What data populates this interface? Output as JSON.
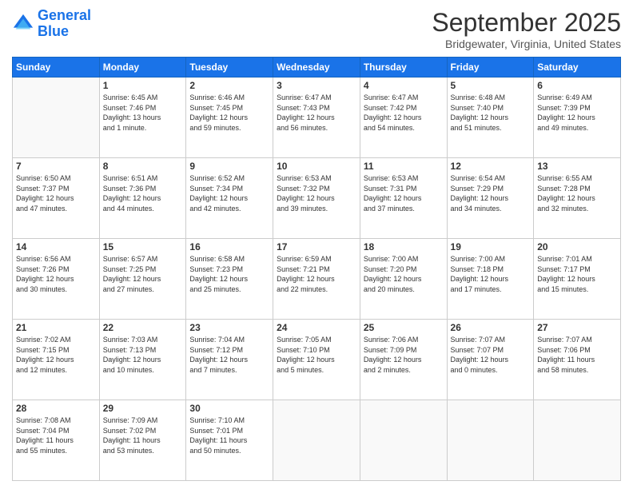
{
  "app": {
    "name_part1": "General",
    "name_part2": "Blue"
  },
  "title": "September 2025",
  "location": "Bridgewater, Virginia, United States",
  "days_of_week": [
    "Sunday",
    "Monday",
    "Tuesday",
    "Wednesday",
    "Thursday",
    "Friday",
    "Saturday"
  ],
  "weeks": [
    [
      {
        "day": "",
        "info": ""
      },
      {
        "day": "1",
        "info": "Sunrise: 6:45 AM\nSunset: 7:46 PM\nDaylight: 13 hours\nand 1 minute."
      },
      {
        "day": "2",
        "info": "Sunrise: 6:46 AM\nSunset: 7:45 PM\nDaylight: 12 hours\nand 59 minutes."
      },
      {
        "day": "3",
        "info": "Sunrise: 6:47 AM\nSunset: 7:43 PM\nDaylight: 12 hours\nand 56 minutes."
      },
      {
        "day": "4",
        "info": "Sunrise: 6:47 AM\nSunset: 7:42 PM\nDaylight: 12 hours\nand 54 minutes."
      },
      {
        "day": "5",
        "info": "Sunrise: 6:48 AM\nSunset: 7:40 PM\nDaylight: 12 hours\nand 51 minutes."
      },
      {
        "day": "6",
        "info": "Sunrise: 6:49 AM\nSunset: 7:39 PM\nDaylight: 12 hours\nand 49 minutes."
      }
    ],
    [
      {
        "day": "7",
        "info": "Sunrise: 6:50 AM\nSunset: 7:37 PM\nDaylight: 12 hours\nand 47 minutes."
      },
      {
        "day": "8",
        "info": "Sunrise: 6:51 AM\nSunset: 7:36 PM\nDaylight: 12 hours\nand 44 minutes."
      },
      {
        "day": "9",
        "info": "Sunrise: 6:52 AM\nSunset: 7:34 PM\nDaylight: 12 hours\nand 42 minutes."
      },
      {
        "day": "10",
        "info": "Sunrise: 6:53 AM\nSunset: 7:32 PM\nDaylight: 12 hours\nand 39 minutes."
      },
      {
        "day": "11",
        "info": "Sunrise: 6:53 AM\nSunset: 7:31 PM\nDaylight: 12 hours\nand 37 minutes."
      },
      {
        "day": "12",
        "info": "Sunrise: 6:54 AM\nSunset: 7:29 PM\nDaylight: 12 hours\nand 34 minutes."
      },
      {
        "day": "13",
        "info": "Sunrise: 6:55 AM\nSunset: 7:28 PM\nDaylight: 12 hours\nand 32 minutes."
      }
    ],
    [
      {
        "day": "14",
        "info": "Sunrise: 6:56 AM\nSunset: 7:26 PM\nDaylight: 12 hours\nand 30 minutes."
      },
      {
        "day": "15",
        "info": "Sunrise: 6:57 AM\nSunset: 7:25 PM\nDaylight: 12 hours\nand 27 minutes."
      },
      {
        "day": "16",
        "info": "Sunrise: 6:58 AM\nSunset: 7:23 PM\nDaylight: 12 hours\nand 25 minutes."
      },
      {
        "day": "17",
        "info": "Sunrise: 6:59 AM\nSunset: 7:21 PM\nDaylight: 12 hours\nand 22 minutes."
      },
      {
        "day": "18",
        "info": "Sunrise: 7:00 AM\nSunset: 7:20 PM\nDaylight: 12 hours\nand 20 minutes."
      },
      {
        "day": "19",
        "info": "Sunrise: 7:00 AM\nSunset: 7:18 PM\nDaylight: 12 hours\nand 17 minutes."
      },
      {
        "day": "20",
        "info": "Sunrise: 7:01 AM\nSunset: 7:17 PM\nDaylight: 12 hours\nand 15 minutes."
      }
    ],
    [
      {
        "day": "21",
        "info": "Sunrise: 7:02 AM\nSunset: 7:15 PM\nDaylight: 12 hours\nand 12 minutes."
      },
      {
        "day": "22",
        "info": "Sunrise: 7:03 AM\nSunset: 7:13 PM\nDaylight: 12 hours\nand 10 minutes."
      },
      {
        "day": "23",
        "info": "Sunrise: 7:04 AM\nSunset: 7:12 PM\nDaylight: 12 hours\nand 7 minutes."
      },
      {
        "day": "24",
        "info": "Sunrise: 7:05 AM\nSunset: 7:10 PM\nDaylight: 12 hours\nand 5 minutes."
      },
      {
        "day": "25",
        "info": "Sunrise: 7:06 AM\nSunset: 7:09 PM\nDaylight: 12 hours\nand 2 minutes."
      },
      {
        "day": "26",
        "info": "Sunrise: 7:07 AM\nSunset: 7:07 PM\nDaylight: 12 hours\nand 0 minutes."
      },
      {
        "day": "27",
        "info": "Sunrise: 7:07 AM\nSunset: 7:06 PM\nDaylight: 11 hours\nand 58 minutes."
      }
    ],
    [
      {
        "day": "28",
        "info": "Sunrise: 7:08 AM\nSunset: 7:04 PM\nDaylight: 11 hours\nand 55 minutes."
      },
      {
        "day": "29",
        "info": "Sunrise: 7:09 AM\nSunset: 7:02 PM\nDaylight: 11 hours\nand 53 minutes."
      },
      {
        "day": "30",
        "info": "Sunrise: 7:10 AM\nSunset: 7:01 PM\nDaylight: 11 hours\nand 50 minutes."
      },
      {
        "day": "",
        "info": ""
      },
      {
        "day": "",
        "info": ""
      },
      {
        "day": "",
        "info": ""
      },
      {
        "day": "",
        "info": ""
      }
    ]
  ]
}
